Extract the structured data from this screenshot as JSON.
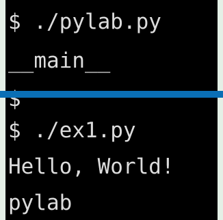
{
  "terminal": {
    "lines": [
      "$ ./pylab.py",
      "__main__",
      "$",
      "$ ./ex1.py",
      "Hello, World!",
      "pylab"
    ]
  },
  "colors": {
    "background": "#000000",
    "text": "#dcdcdc",
    "divider": "#0a6fb5",
    "frame": "#e4efe6"
  }
}
